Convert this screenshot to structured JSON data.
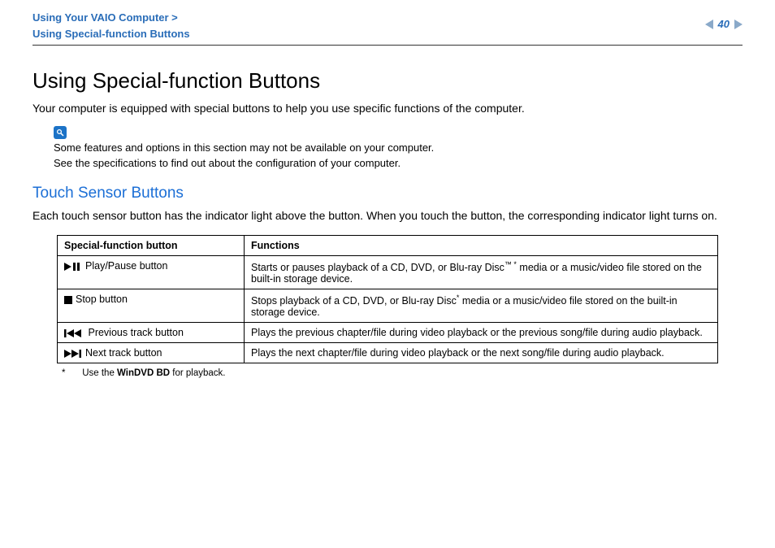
{
  "header": {
    "breadcrumb_line1": "Using Your VAIO Computer >",
    "breadcrumb_line2": "Using Special-function Buttons",
    "page_number": "40"
  },
  "title": "Using Special-function Buttons",
  "intro": "Your computer is equipped with special buttons to help you use specific functions of the computer.",
  "note": {
    "line1": "Some features and options in this section may not be available on your computer.",
    "line2": "See the specifications to find out about the configuration of your computer."
  },
  "section_title": "Touch Sensor Buttons",
  "section_intro": "Each touch sensor button has the indicator light above the button. When you touch the button, the corresponding indicator light turns on.",
  "table": {
    "header_col1": "Special-function button",
    "header_col2": "Functions",
    "rows": [
      {
        "button_label": "Play/Pause button",
        "func_pre": "Starts or pauses playback of a CD, DVD, or Blu-ray Disc",
        "func_sup": "™ *",
        "func_post": " media or a music/video file stored on the built-in storage device."
      },
      {
        "button_label": "Stop button",
        "func_pre": "Stops playback of a CD, DVD, or Blu-ray Disc",
        "func_sup": "*",
        "func_post": " media or a music/video file stored on the built-in storage device."
      },
      {
        "button_label": "Previous track button",
        "func_pre": "Plays the previous chapter/file during video playback or the previous song/file during audio playback.",
        "func_sup": "",
        "func_post": ""
      },
      {
        "button_label": "Next track button",
        "func_pre": "Plays the next chapter/file during video playback or the next song/file during audio playback.",
        "func_sup": "",
        "func_post": ""
      }
    ]
  },
  "footnote": {
    "marker": "*",
    "text_pre": "Use the ",
    "text_bold": "WinDVD BD",
    "text_post": " for playback."
  }
}
